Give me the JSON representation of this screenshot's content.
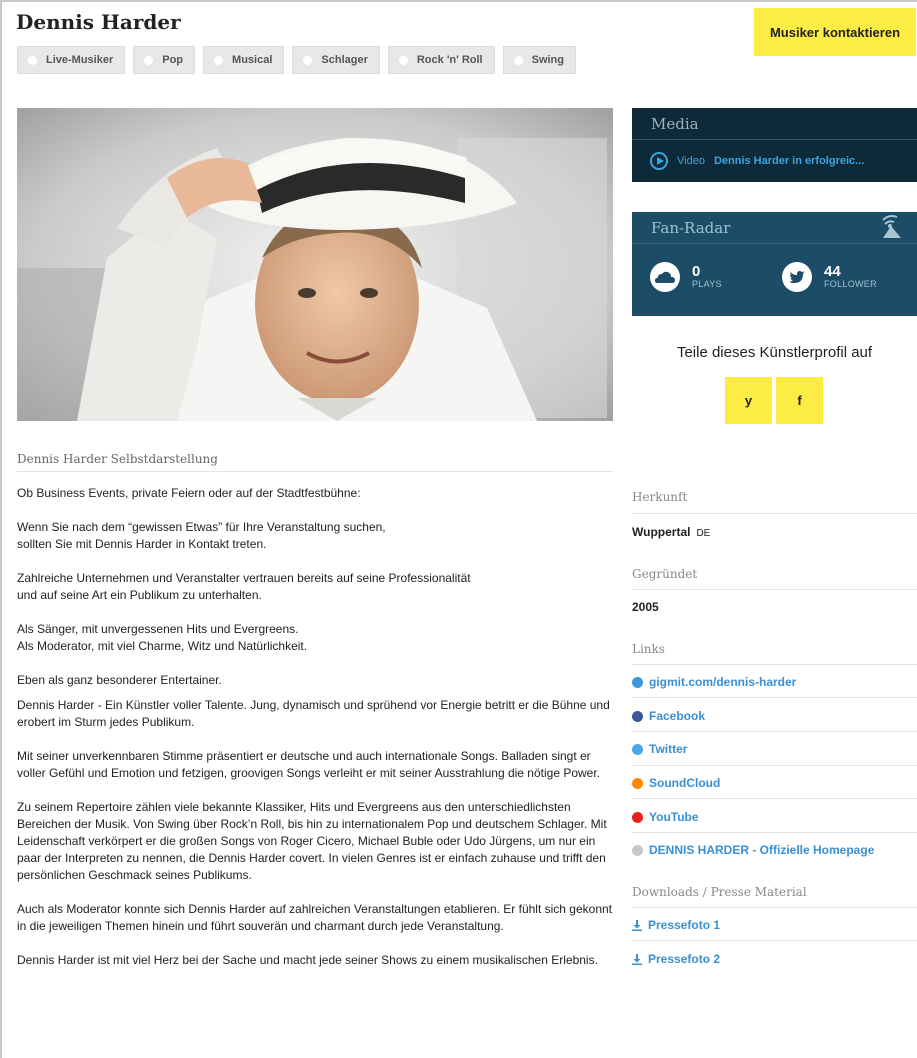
{
  "artist": {
    "name": "Dennis Harder",
    "tags": [
      "Live-Musiker",
      "Pop",
      "Musical",
      "Schlager",
      "Rock 'n' Roll",
      "Swing"
    ]
  },
  "actions": {
    "contact_label": "Musiker kontaktieren"
  },
  "bio": {
    "section_title": "Dennis Harder Selbstdarstellung",
    "p1": "Ob Business Events, private Feiern oder auf der Stadtfestbühne:",
    "p2a": "Wenn Sie nach dem “gewissen Etwas” für Ihre Veranstaltung suchen,",
    "p2b": "sollten Sie mit Dennis Harder in Kontakt treten.",
    "p3a": "Zahlreiche Unternehmen und Veranstalter vertrauen bereits auf seine Professionalität",
    "p3b": "und auf seine Art ein Publikum zu unterhalten.",
    "p4a": "Als Sänger, mit unvergessenen Hits und Evergreens.",
    "p4b": "Als Moderator, mit viel Charme, Witz und Natürlichkeit.",
    "p5": "Eben als ganz besonderer Entertainer.",
    "p6": "Dennis Harder - Ein Künstler voller Talente. Jung, dynamisch und sprühend vor Energie betritt er die Bühne und erobert im Sturm jedes Publikum.",
    "p7": "Mit seiner unverkennbaren Stimme präsentiert er deutsche und auch internationale Songs. Balladen singt er voller Gefühl und Emotion und fetzigen, groovigen Songs verleiht er mit seiner Ausstrahlung die nötige Power.",
    "p8": "Zu seinem Repertoire zählen viele bekannte Klassiker, Hits und Evergreens aus den unterschiedlichsten Bereichen der Musik. Von Swing über Rock’n Roll, bis hin zu internationalem Pop und deutschem Schlager. Mit Leidenschaft verkörpert er die großen Songs von Roger Cicero, Michael Buble oder Udo Jürgens, um nur ein paar der Interpreten zu nennen, die Dennis Harder covert. In vielen Genres ist er einfach zuhause und trifft den persönlichen Geschmack seines Publikums.",
    "p9": "Auch als Moderator konnte sich Dennis Harder auf zahlreichen Veranstaltungen etablieren. Er fühlt sich gekonnt in die jeweiligen Themen hinein und führt souverän und charmant durch jede Veranstaltung.",
    "p10": "Dennis Harder ist mit viel Herz bei der Sache und macht jede seiner Shows zu einem musikalischen Erlebnis."
  },
  "media": {
    "heading": "Media",
    "type": "Video",
    "title": "Dennis Harder in erfolgreic..."
  },
  "fan_radar": {
    "heading": "Fan-Radar",
    "soundcloud_count": "0",
    "soundcloud_label": "PLAYS",
    "twitter_count": "44",
    "twitter_label": "FOLLOWER"
  },
  "share": {
    "text": "Teile dieses Künstlerprofil auf",
    "twitter_glyph": "y",
    "facebook_glyph": "f"
  },
  "info": {
    "origin_label": "Herkunft",
    "origin_city": "Wuppertal",
    "origin_country": "DE",
    "founded_label": "Gegründet",
    "founded_year": "2005",
    "links_label": "Links",
    "links": [
      {
        "label": "gigmit.com/dennis-harder",
        "color": "#3a9ad9"
      },
      {
        "label": "Facebook",
        "color": "#3b5998"
      },
      {
        "label": "Twitter",
        "color": "#4aa8e8"
      },
      {
        "label": "SoundCloud",
        "color": "#ff8800"
      },
      {
        "label": "YouTube",
        "color": "#e62117"
      },
      {
        "label": "DENNIS HARDER - Offizielle Homepage",
        "color": "#c8c8c8"
      }
    ],
    "downloads_label": "Downloads / Presse Material",
    "downloads": [
      "Pressefoto 1",
      "Pressefoto 2"
    ]
  },
  "colors": {
    "accent_yellow": "#fdec44",
    "media_bg": "#0e2a38",
    "fan_bg": "#1d4c66",
    "link_blue": "#3a8fd2"
  }
}
